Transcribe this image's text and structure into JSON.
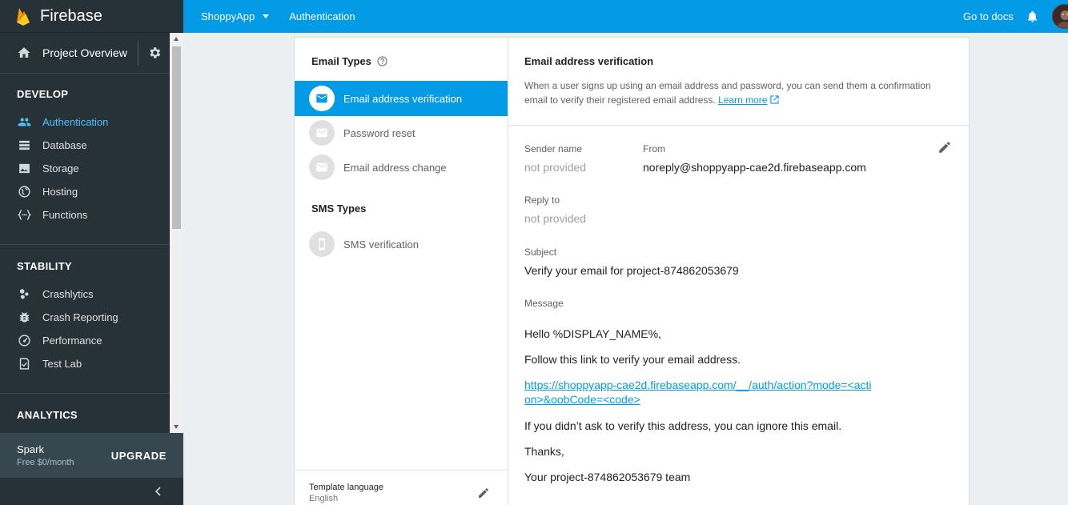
{
  "sidebar": {
    "brand": "Firebase",
    "project_overview": "Project Overview",
    "sections": {
      "develop": {
        "title": "DEVELOP",
        "items": [
          {
            "label": "Authentication",
            "icon": "people-icon",
            "active": true
          },
          {
            "label": "Database",
            "icon": "database-icon"
          },
          {
            "label": "Storage",
            "icon": "image-icon"
          },
          {
            "label": "Hosting",
            "icon": "globe-icon"
          },
          {
            "label": "Functions",
            "icon": "functions-icon"
          }
        ]
      },
      "stability": {
        "title": "STABILITY",
        "items": [
          {
            "label": "Crashlytics",
            "icon": "crashlytics-icon"
          },
          {
            "label": "Crash Reporting",
            "icon": "bug-icon"
          },
          {
            "label": "Performance",
            "icon": "speedometer-icon"
          },
          {
            "label": "Test Lab",
            "icon": "checklist-icon"
          }
        ]
      },
      "analytics": {
        "title": "ANALYTICS"
      }
    },
    "plan": {
      "name": "Spark",
      "price": "Free $0/month",
      "upgrade": "UPGRADE"
    }
  },
  "topbar": {
    "project": "ShoppyApp",
    "breadcrumb": "Authentication",
    "docs": "Go to docs"
  },
  "templates": {
    "email_types_title": "Email Types",
    "sms_types_title": "SMS Types",
    "email_types": [
      {
        "label": "Email address verification",
        "active": true
      },
      {
        "label": "Password reset"
      },
      {
        "label": "Email address change"
      }
    ],
    "sms_types": [
      {
        "label": "SMS verification"
      }
    ],
    "template_language_label": "Template language",
    "template_language_value": "English"
  },
  "detail": {
    "title": "Email address verification",
    "description": "When a user signs up using an email address and password, you can send them a confirmation email to verify their registered email address.",
    "learn_more": "Learn more",
    "sender_name_label": "Sender name",
    "sender_name_value": "not provided",
    "from_label": "From",
    "from_value": "noreply@shoppyapp-cae2d.firebaseapp.com",
    "reply_to_label": "Reply to",
    "reply_to_value": "not provided",
    "subject_label": "Subject",
    "subject_value": "Verify your email for project-874862053679",
    "message_label": "Message",
    "message_greeting": "Hello %DISPLAY_NAME%,",
    "message_line1": "Follow this link to verify your email address.",
    "message_link": "https://shoppyapp-cae2d.firebaseapp.com/__/auth/action?mode=<action>&oobCode=<code>",
    "message_line2": "If you didn’t ask to verify this address, you can ignore this email.",
    "message_thanks": "Thanks,",
    "message_signature": "Your project-874862053679 team"
  },
  "colors": {
    "accent": "#039be5",
    "sidebar_bg": "#263238",
    "active_link": "#4fc3f7"
  }
}
